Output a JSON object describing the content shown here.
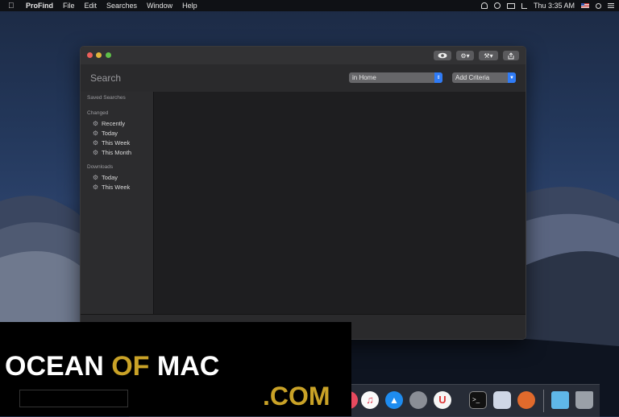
{
  "menubar": {
    "app_name": "ProFind",
    "menus": [
      "File",
      "Edit",
      "Searches",
      "Window",
      "Help"
    ],
    "clock": "Thu 3:35 AM"
  },
  "window": {
    "search_placeholder": "Search",
    "scope_popup": "in Home",
    "criteria_popup": "Add Criteria",
    "sidebar": {
      "saved_searches_heading": "Saved Searches",
      "changed_heading": "Changed",
      "changed_items": [
        "Recently",
        "Today",
        "This Week",
        "This Month"
      ],
      "downloads_heading": "Downloads",
      "downloads_items": [
        "Today",
        "This Week"
      ]
    }
  },
  "watermark": {
    "word1": "OCEAN ",
    "word2": "OF",
    "word3": " MAC",
    "suffix": ".COM"
  },
  "colors": {
    "accent": "#2f7bf6",
    "close": "#ec5f5a",
    "minimize": "#e0b43c",
    "zoom": "#5fbf49",
    "watermark_gold": "#c9a227"
  }
}
